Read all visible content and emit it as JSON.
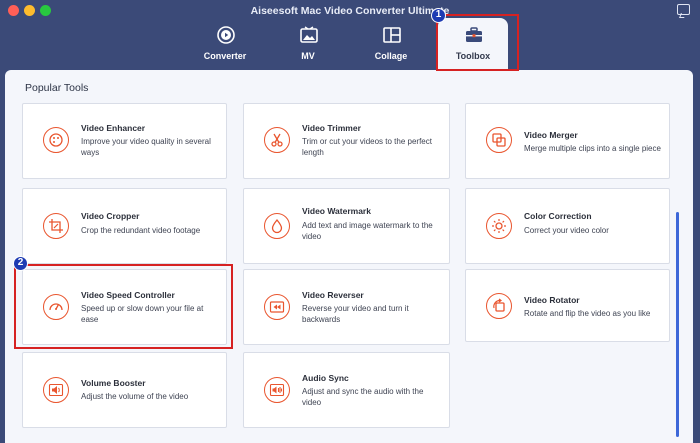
{
  "window": {
    "title": "Aiseesoft Mac Video Converter Ultimate"
  },
  "tabs": [
    {
      "label": "Converter",
      "icon": "converter-icon"
    },
    {
      "label": "MV",
      "icon": "mv-icon"
    },
    {
      "label": "Collage",
      "icon": "collage-icon"
    },
    {
      "label": "Toolbox",
      "icon": "toolbox-icon",
      "active": true
    }
  ],
  "annotations": {
    "marker_1": "1",
    "marker_2": "2",
    "highlight_color": "#d62222",
    "marker_color": "#1e3bb3"
  },
  "section": {
    "title": "Popular Tools"
  },
  "colors": {
    "accent": "#e9552e",
    "header_bg": "#3b4a78",
    "panel_bg": "#f4f6fb"
  },
  "tools": [
    {
      "title": "Video Enhancer",
      "desc": "Improve your video quality in several ways",
      "icon": "palette-icon"
    },
    {
      "title": "Video Trimmer",
      "desc": "Trim or cut your videos to the perfect length",
      "icon": "scissors-icon"
    },
    {
      "title": "Video Merger",
      "desc": "Merge multiple clips into a single piece",
      "icon": "merge-icon"
    },
    {
      "title": "Video Cropper",
      "desc": "Crop the redundant video footage",
      "icon": "crop-icon"
    },
    {
      "title": "Video Watermark",
      "desc": "Add text and image watermark to the video",
      "icon": "droplet-icon"
    },
    {
      "title": "Color Correction",
      "desc": "Correct your video color",
      "icon": "sun-icon"
    },
    {
      "title": "Video Speed Controller",
      "desc": "Speed up or slow down your file at ease",
      "icon": "speedometer-icon"
    },
    {
      "title": "Video Reverser",
      "desc": "Reverse your video and turn it backwards",
      "icon": "rewind-icon"
    },
    {
      "title": "Video Rotator",
      "desc": "Rotate and flip the video as you like",
      "icon": "rotate-icon"
    },
    {
      "title": "Volume Booster",
      "desc": "Adjust the volume of the video",
      "icon": "volume-icon"
    },
    {
      "title": "Audio Sync",
      "desc": "Adjust and sync the audio with the video",
      "icon": "audio-sync-icon"
    }
  ]
}
